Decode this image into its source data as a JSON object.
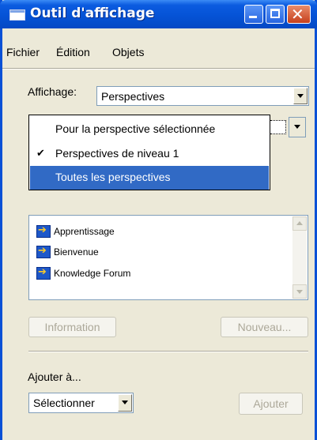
{
  "window": {
    "title": "Outil d'affichage"
  },
  "menubar": {
    "items": [
      "Fichier",
      "Édition",
      "Objets"
    ]
  },
  "affichage": {
    "label": "Affichage:",
    "value": "Perspectives"
  },
  "dropdown": {
    "items": [
      {
        "label": "Pour la perspective sélectionnée",
        "checked": false,
        "highlighted": false
      },
      {
        "label": "Perspectives de niveau 1",
        "checked": true,
        "highlighted": false
      },
      {
        "label": "Toutes les perspectives",
        "checked": false,
        "highlighted": true
      }
    ]
  },
  "list": {
    "items": [
      {
        "label": "Apprentissage",
        "icon": "arrow-icon"
      },
      {
        "label": "Bienvenue",
        "icon": "arrow-icon"
      },
      {
        "label": "Knowledge Forum",
        "icon": "arrow-icon"
      }
    ]
  },
  "buttons": {
    "information": "Information",
    "nouveau": "Nouveau...",
    "ajouter": "Ajouter"
  },
  "ajouter_section": {
    "label": "Ajouter à...",
    "select_value": "Sélectionner"
  },
  "colors": {
    "titlebar": "#0553d6",
    "highlight": "#316ac5",
    "window_bg": "#ece9d8"
  }
}
